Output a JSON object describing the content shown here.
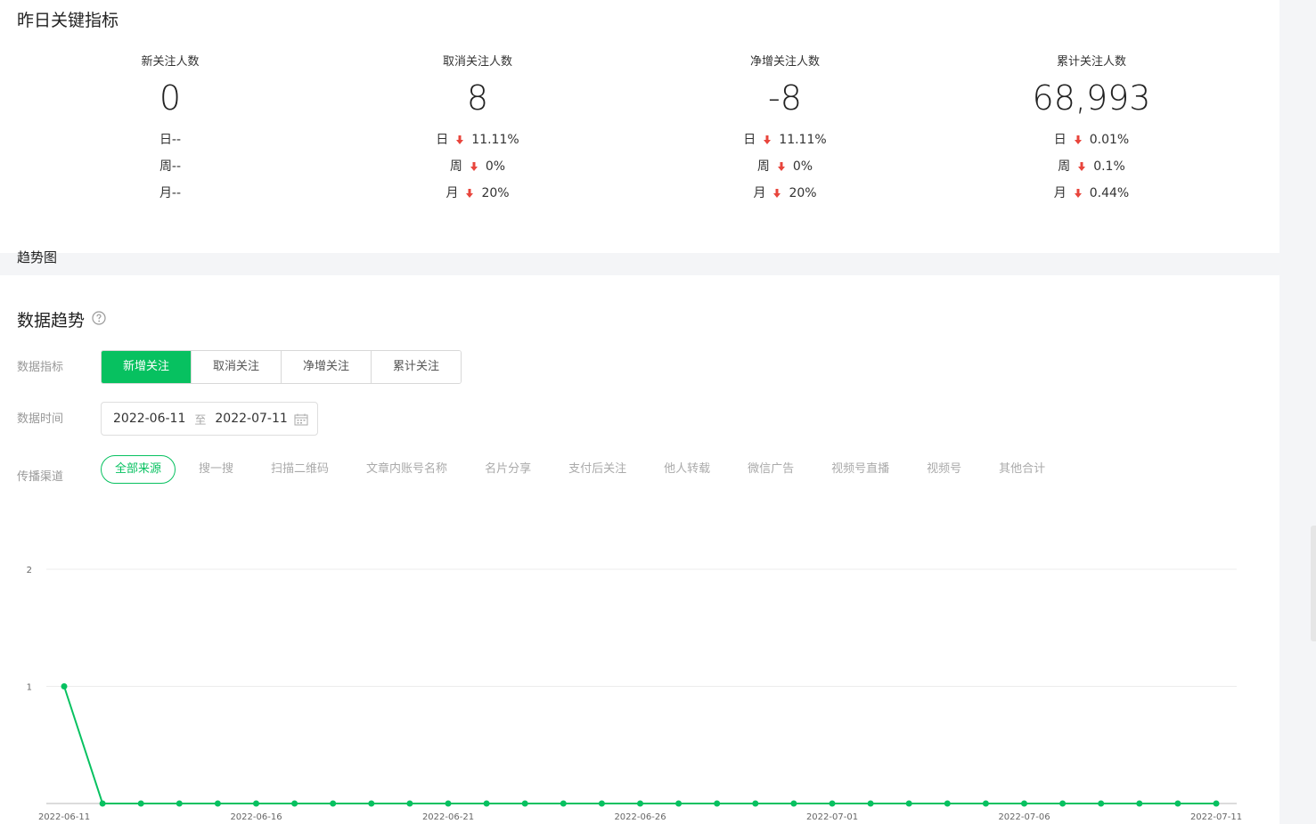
{
  "overview": {
    "title": "昨日关键指标",
    "kpis": [
      {
        "label": "新关注人数",
        "value": "0",
        "rows": [
          {
            "period": "日--",
            "pct": "",
            "trend": ""
          },
          {
            "period": "周--",
            "pct": "",
            "trend": ""
          },
          {
            "period": "月--",
            "pct": "",
            "trend": ""
          }
        ]
      },
      {
        "label": "取消关注人数",
        "value": "8",
        "rows": [
          {
            "period": "日",
            "pct": "11.11%",
            "trend": "down"
          },
          {
            "period": "周",
            "pct": "0%",
            "trend": "down"
          },
          {
            "period": "月",
            "pct": "20%",
            "trend": "down"
          }
        ]
      },
      {
        "label": "净增关注人数",
        "value": "-8",
        "rows": [
          {
            "period": "日",
            "pct": "11.11%",
            "trend": "down"
          },
          {
            "period": "周",
            "pct": "0%",
            "trend": "down"
          },
          {
            "period": "月",
            "pct": "20%",
            "trend": "down"
          }
        ]
      },
      {
        "label": "累计关注人数",
        "value": "68,993",
        "rows": [
          {
            "period": "日",
            "pct": "0.01%",
            "trend": "down"
          },
          {
            "period": "周",
            "pct": "0.1%",
            "trend": "down"
          },
          {
            "period": "月",
            "pct": "0.44%",
            "trend": "down"
          }
        ]
      }
    ]
  },
  "trend": {
    "title": "数据趋势",
    "help_icon": "question-circle-icon",
    "metric_label": "数据指标",
    "metrics": [
      "新增关注",
      "取消关注",
      "净增关注",
      "累计关注"
    ],
    "active_metric": 0,
    "time_label": "数据时间",
    "date_start": "2022-06-11",
    "date_sep": "至",
    "date_end": "2022-07-11",
    "calendar_icon": "calendar-icon",
    "channel_label": "传播渠道",
    "channels": [
      "全部来源",
      "搜一搜",
      "扫描二维码",
      "文章内账号名称",
      "名片分享",
      "支付后关注",
      "他人转载",
      "微信广告",
      "视频号直播",
      "视频号",
      "其他合计"
    ],
    "active_channel": 0,
    "chart_title": "趋势图"
  },
  "colors": {
    "accent": "#07c160",
    "down": "#e8453c",
    "grid": "#ececec"
  },
  "chart_data": {
    "type": "line",
    "title": "趋势图",
    "xlabel": "",
    "ylabel": "",
    "x": [
      "2022-06-11",
      "2022-06-12",
      "2022-06-13",
      "2022-06-14",
      "2022-06-15",
      "2022-06-16",
      "2022-06-17",
      "2022-06-18",
      "2022-06-19",
      "2022-06-20",
      "2022-06-21",
      "2022-06-22",
      "2022-06-23",
      "2022-06-24",
      "2022-06-25",
      "2022-06-26",
      "2022-06-27",
      "2022-06-28",
      "2022-06-29",
      "2022-06-30",
      "2022-07-01",
      "2022-07-02",
      "2022-07-03",
      "2022-07-04",
      "2022-07-05",
      "2022-07-06",
      "2022-07-07",
      "2022-07-08",
      "2022-07-09",
      "2022-07-10",
      "2022-07-11"
    ],
    "series": [
      {
        "values": [
          1,
          0,
          0,
          0,
          0,
          0,
          0,
          0,
          0,
          0,
          0,
          0,
          0,
          0,
          0,
          0,
          0,
          0,
          0,
          0,
          0,
          0,
          0,
          0,
          0,
          0,
          0,
          0,
          0,
          0,
          0
        ]
      }
    ],
    "x_tick_labels": [
      "2022-06-11",
      "2022-06-16",
      "2022-06-21",
      "2022-06-26",
      "2022-07-01",
      "2022-07-06",
      "2022-07-11"
    ],
    "y_tick_labels": [
      "1",
      "2"
    ],
    "ylim": [
      0,
      2
    ],
    "grid": true,
    "legend": "none"
  }
}
